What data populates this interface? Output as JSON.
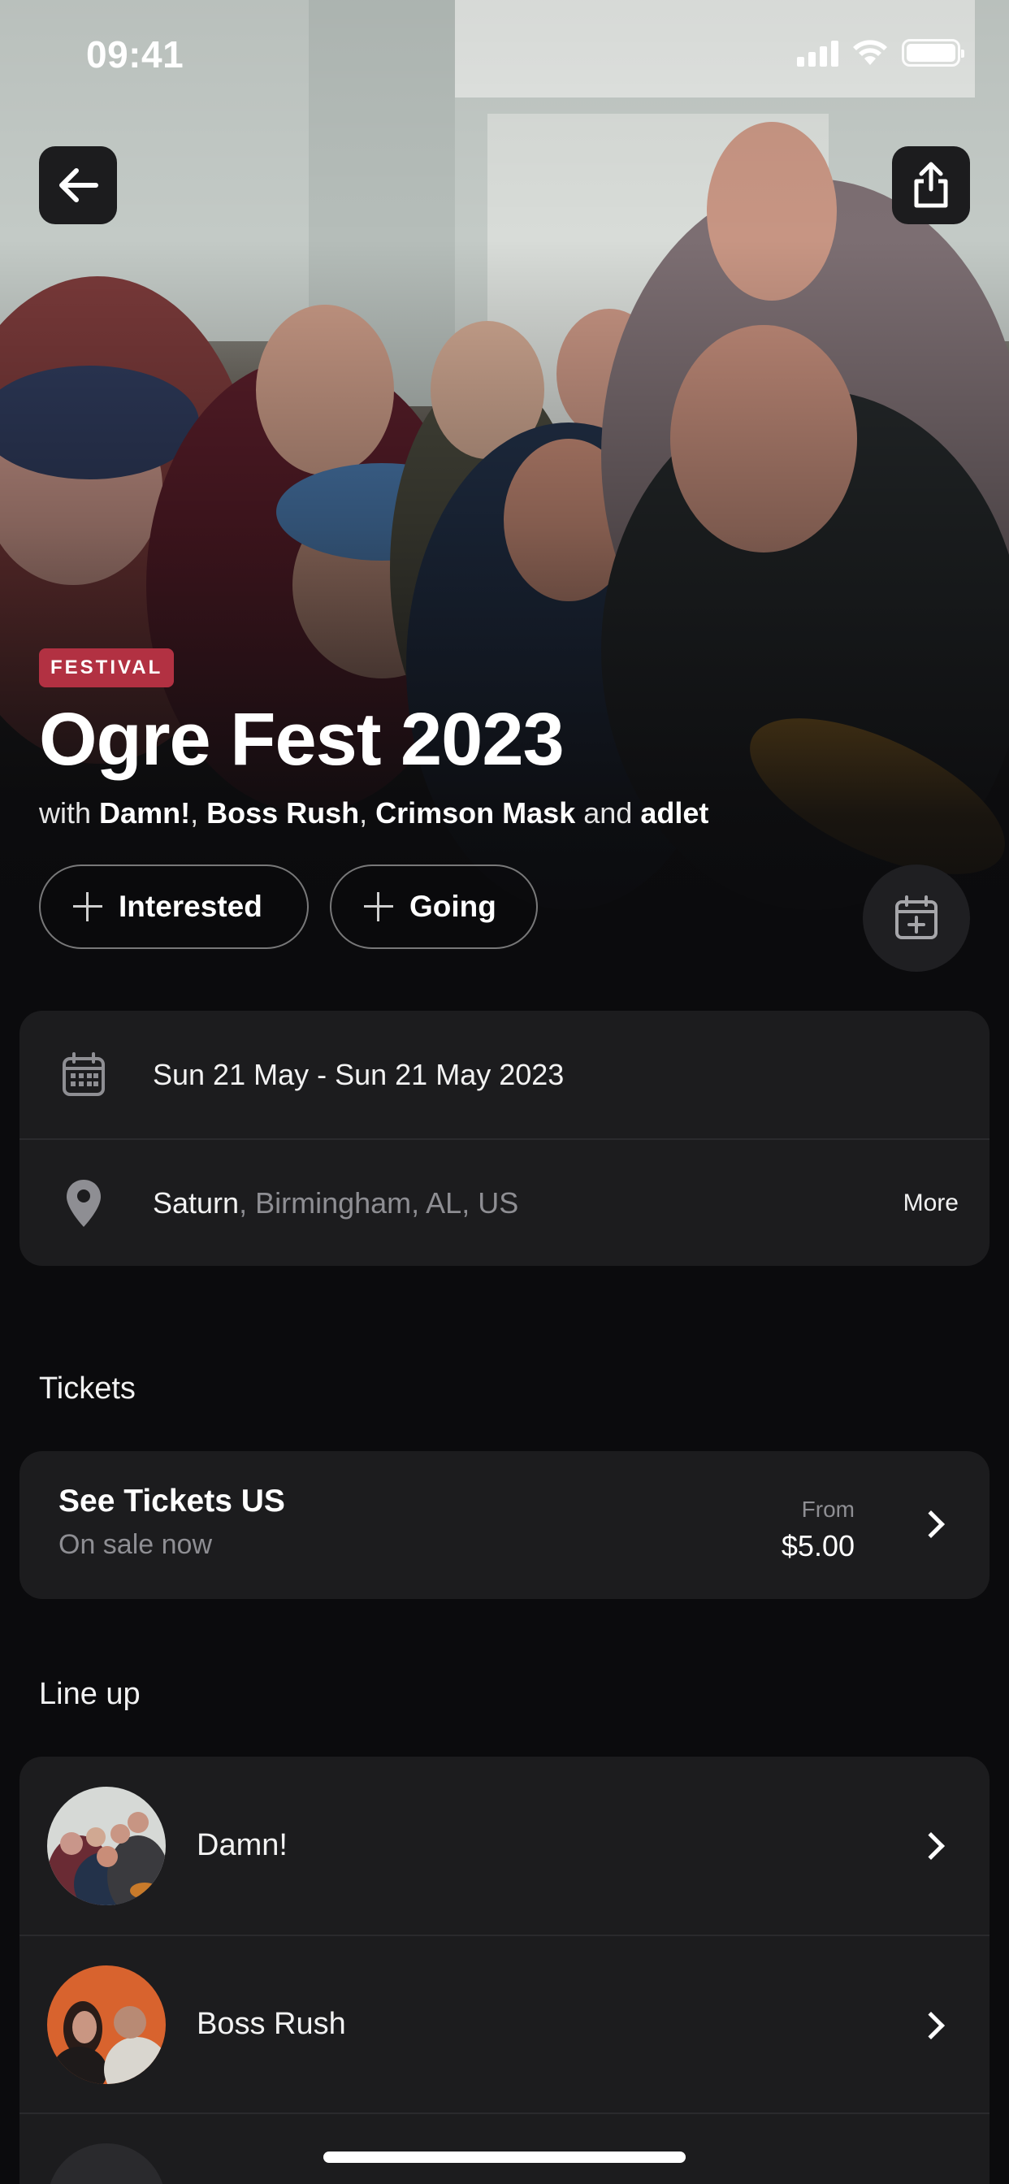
{
  "status_bar": {
    "time": "09:41"
  },
  "event": {
    "badge": "FESTIVAL",
    "title": "Ogre Fest 2023",
    "with_prefix": "with",
    "with_artists": [
      "Damn!",
      "Boss Rush",
      "Crimson Mask"
    ],
    "with_joiner": "and",
    "with_last": "adlet"
  },
  "actions": {
    "interested_label": "Interested",
    "going_label": "Going"
  },
  "info": {
    "dates": "Sun 21 May - Sun 21 May 2023",
    "venue": "Saturn",
    "location": ", Birmingham, AL, US",
    "more_label": "More"
  },
  "tickets": {
    "section_title": "Tickets",
    "vendor": "See Tickets US",
    "status": "On sale now",
    "from_label": "From",
    "price": "$5.00"
  },
  "lineup": {
    "section_title": "Line up",
    "artists": [
      {
        "name": "Damn!"
      },
      {
        "name": "Boss Rush"
      }
    ]
  },
  "colors": {
    "background": "#0b0b0d",
    "card": "#1c1c1e",
    "badge": "#b23142",
    "muted_text": "#8e8e93"
  },
  "icons": [
    "back-arrow-icon",
    "share-icon",
    "plus-icon",
    "calendar-add-icon",
    "calendar-icon",
    "location-pin-icon",
    "chevron-right-icon"
  ]
}
